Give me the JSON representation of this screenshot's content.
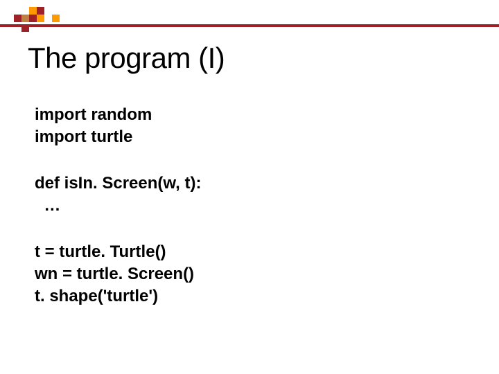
{
  "slide": {
    "title": "The program (I)",
    "blocks": [
      {
        "lines": [
          "import random",
          "import turtle"
        ]
      },
      {
        "lines": [
          "def isIn. Screen(w, t):",
          "  …"
        ]
      },
      {
        "lines": [
          "t = turtle. Turtle()",
          "wn = turtle. Screen()",
          "t. shape('turtle')"
        ]
      }
    ]
  }
}
